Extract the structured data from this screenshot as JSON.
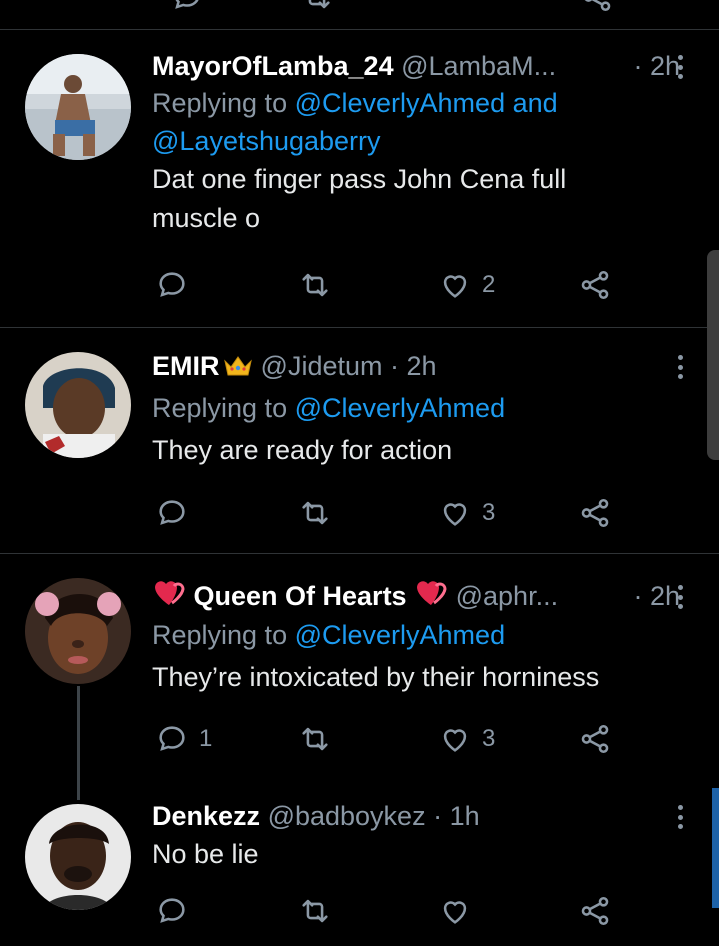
{
  "tweets": [
    {
      "name": "MayorOfLamba_24",
      "handle": "@LambaM...",
      "time": "· 2h",
      "replying_prefix": "Replying to",
      "mentions": [
        "@CleverlyAhmed",
        "and",
        "@Layetshugaberry"
      ],
      "text_lines": [
        "Dat one finger pass John Cena full",
        "muscle o"
      ],
      "reply_count": "",
      "retweet_count": "",
      "like_count": "2"
    },
    {
      "name": "EMIR",
      "name_emoji": "crown-emoji",
      "handle": "@Jidetum",
      "time": "· 2h",
      "replying_prefix": "Replying to",
      "mentions": [
        "@CleverlyAhmed"
      ],
      "text_lines": [
        "They are ready for action"
      ],
      "reply_count": "",
      "retweet_count": "",
      "like_count": "3"
    },
    {
      "name": "Queen Of Hearts",
      "name_emoji": "heart-ribbon-emoji",
      "handle": "@aphr...",
      "time": "· 2h",
      "replying_prefix": "Replying to",
      "mentions": [
        "@CleverlyAhmed"
      ],
      "text_lines": [
        "They’re intoxicated by their horniness"
      ],
      "reply_count": "1",
      "retweet_count": "",
      "like_count": "3"
    },
    {
      "name": "Denkezz",
      "handle": "@badboykez",
      "time": "· 1h",
      "text_lines": [
        "No be lie"
      ],
      "reply_count": "",
      "retweet_count": "",
      "like_count": ""
    }
  ],
  "icons": {
    "reply": "reply-icon",
    "retweet": "retweet-icon",
    "like": "heart-icon",
    "share": "share-icon",
    "more": "more-vertical-icon"
  },
  "colors": {
    "background": "#000000",
    "mention": "#1d9bf0",
    "secondary_text": "#8b98a5",
    "primary_text": "#e7e9ea",
    "divider": "#2f3336"
  }
}
